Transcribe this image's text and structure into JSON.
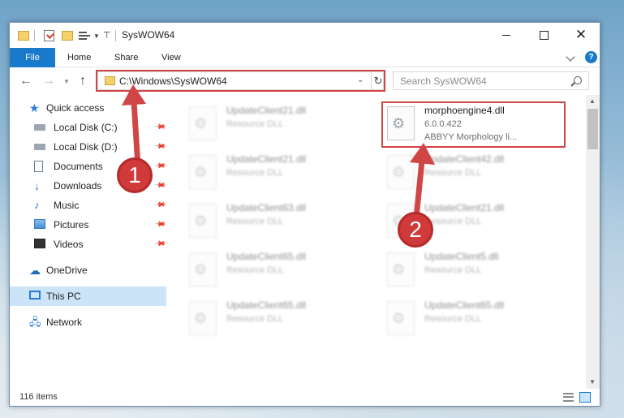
{
  "window": {
    "title": "SysWOW64"
  },
  "ribbon": {
    "file_tab": "File",
    "tabs": [
      "Home",
      "Share",
      "View"
    ]
  },
  "nav": {
    "address": "C:\\Windows\\SysWOW64",
    "search_placeholder": "Search SysWOW64"
  },
  "sidebar": {
    "quick_access": "Quick access",
    "quick_items": [
      {
        "label": "Local Disk (C:)",
        "icon": "drive-icon"
      },
      {
        "label": "Local Disk (D:)",
        "icon": "drive-icon"
      },
      {
        "label": "Documents",
        "icon": "documents-icon"
      },
      {
        "label": "Downloads",
        "icon": "downloads-icon"
      },
      {
        "label": "Music",
        "icon": "music-icon"
      },
      {
        "label": "Pictures",
        "icon": "pictures-icon"
      },
      {
        "label": "Videos",
        "icon": "videos-icon"
      }
    ],
    "onedrive": "OneDrive",
    "this_pc": "This PC",
    "network": "Network"
  },
  "files": {
    "target": {
      "name": "morphoengine4.dll",
      "version": "6.0.0.422",
      "description": "ABBYY Morphology li..."
    },
    "left_column": [
      {
        "name": "UpdateClient21.dll",
        "type": "Resource DLL"
      },
      {
        "name": "UpdateClient21.dll",
        "type": "Resource DLL"
      },
      {
        "name": "UpdateClient63.dll",
        "type": "Resource DLL"
      },
      {
        "name": "UpdateClient65.dll",
        "type": "Resource DLL"
      },
      {
        "name": "UpdateClient65.dll",
        "type": "Resource DLL"
      }
    ],
    "right_column": [
      {
        "name": "UpdateClient42.dll",
        "type": "Resource DLL"
      },
      {
        "name": "UpdateClient21.dll",
        "type": "Resource DLL"
      },
      {
        "name": "UpdateClient5.dll",
        "type": "Resource DLL"
      },
      {
        "name": "UpdateClient65.dll",
        "type": "Resource DLL"
      }
    ]
  },
  "status": {
    "item_count": "116 items"
  },
  "annotations": {
    "step1": "1",
    "step2": "2",
    "color": "#d04545"
  }
}
